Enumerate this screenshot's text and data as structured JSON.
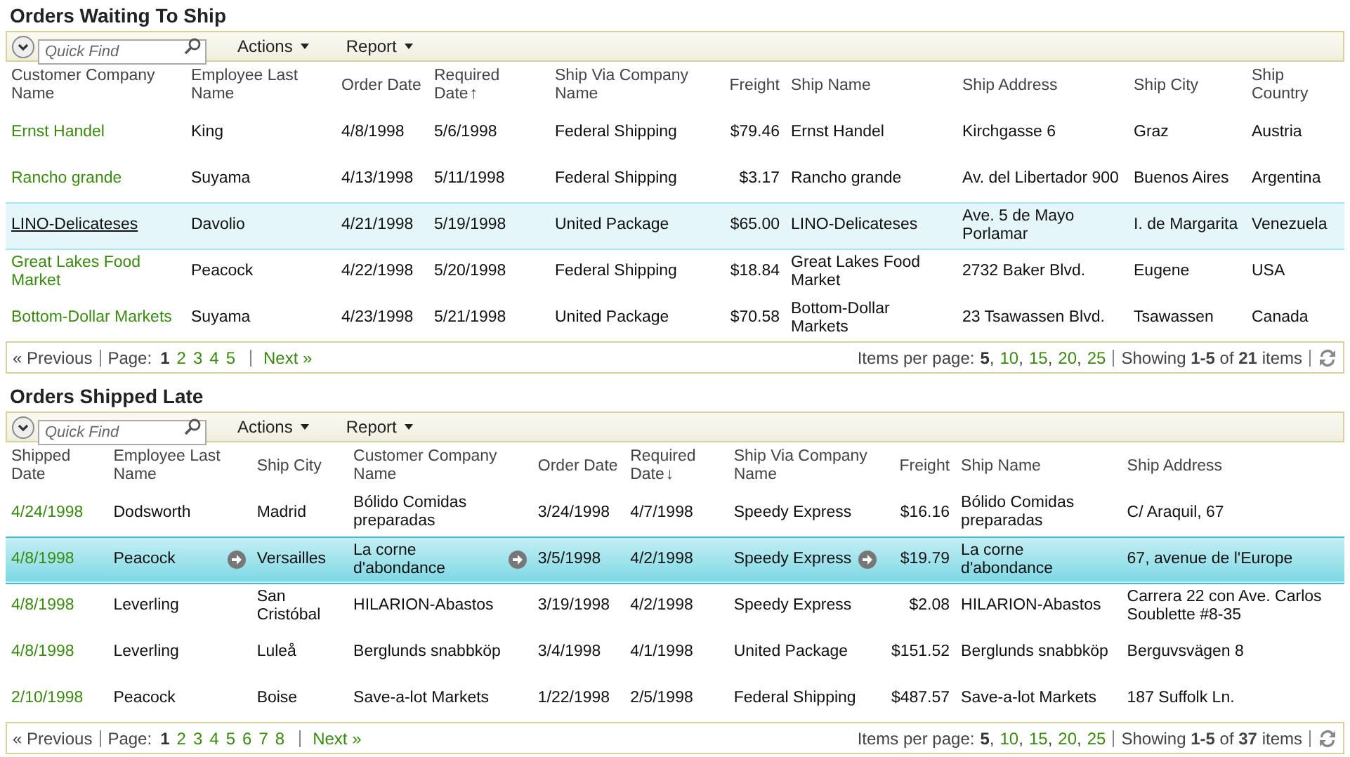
{
  "grids": [
    {
      "title": "Orders Waiting To Ship",
      "quick_find": {
        "placeholder": "Quick Find"
      },
      "menus": [
        "Actions",
        "Report"
      ],
      "columns": [
        {
          "label": "Customer Company Name",
          "kind": "link"
        },
        {
          "label": "Employee Last Name",
          "kind": "text"
        },
        {
          "label": "Order Date",
          "kind": "text"
        },
        {
          "label": "Required Date",
          "kind": "text",
          "sort_arrow": "↑"
        },
        {
          "label": "Ship Via Company Name",
          "kind": "text"
        },
        {
          "label": "Freight",
          "kind": "number"
        },
        {
          "label": "Ship Name",
          "kind": "text"
        },
        {
          "label": "Ship Address",
          "kind": "text"
        },
        {
          "label": "Ship City",
          "kind": "text"
        },
        {
          "label": "Ship Country",
          "kind": "text"
        }
      ],
      "rows": [
        {
          "selected": false,
          "hovered": false,
          "cells": [
            "Ernst Handel",
            "King",
            "4/8/1998",
            "5/6/1998",
            "Federal Shipping",
            "$79.46",
            "Ernst Handel",
            "Kirchgasse 6",
            "Graz",
            "Austria"
          ]
        },
        {
          "selected": false,
          "hovered": false,
          "cells": [
            "Rancho grande",
            "Suyama",
            "4/13/1998",
            "5/11/1998",
            "Federal Shipping",
            "$3.17",
            "Rancho grande",
            "Av. del Libertador 900",
            "Buenos Aires",
            "Argentina"
          ]
        },
        {
          "selected": false,
          "hovered": true,
          "cells": [
            "LINO-Delicateses",
            "Davolio",
            "4/21/1998",
            "5/19/1998",
            "United Package",
            "$65.00",
            "LINO-Delicateses",
            "Ave. 5 de Mayo Porlamar",
            "I. de Margarita",
            "Venezuela"
          ]
        },
        {
          "selected": false,
          "hovered": false,
          "cells": [
            "Great Lakes Food Market",
            "Peacock",
            "4/22/1998",
            "5/20/1998",
            "Federal Shipping",
            "$18.84",
            "Great Lakes Food Market",
            "2732 Baker Blvd.",
            "Eugene",
            "USA"
          ]
        },
        {
          "selected": false,
          "hovered": false,
          "cells": [
            "Bottom-Dollar Markets",
            "Suyama",
            "4/23/1998",
            "5/21/1998",
            "United Package",
            "$70.58",
            "Bottom-Dollar Markets",
            "23 Tsawassen Blvd.",
            "Tsawassen",
            "Canada"
          ]
        }
      ],
      "pager": {
        "previous": "« Previous",
        "page_label": "Page:",
        "pages": [
          {
            "label": "1",
            "selected": true
          },
          {
            "label": "2",
            "selected": false
          },
          {
            "label": "3",
            "selected": false
          },
          {
            "label": "4",
            "selected": false
          },
          {
            "label": "5",
            "selected": false
          }
        ],
        "next": "Next »",
        "items_label": "Items per page:",
        "separator": ",",
        "sizes": [
          {
            "label": "5",
            "selected": true
          },
          {
            "label": "10",
            "selected": false
          },
          {
            "label": "15",
            "selected": false
          },
          {
            "label": "20",
            "selected": false
          },
          {
            "label": "25",
            "selected": false
          }
        ],
        "showing": "Showing **1-5** of **21** items"
      }
    },
    {
      "title": "Orders Shipped Late",
      "quick_find": {
        "placeholder": "Quick Find"
      },
      "menus": [
        "Actions",
        "Report"
      ],
      "columns": [
        {
          "label": "Shipped Date",
          "kind": "link"
        },
        {
          "label": "Employee Last Name",
          "kind": "text",
          "action": true
        },
        {
          "label": "Ship City",
          "kind": "text"
        },
        {
          "label": "Customer Company Name",
          "kind": "text",
          "action": true
        },
        {
          "label": "Order Date",
          "kind": "text"
        },
        {
          "label": "Required Date",
          "kind": "text",
          "sort_arrow": "↓"
        },
        {
          "label": "Ship Via Company Name",
          "kind": "text",
          "action": true
        },
        {
          "label": "Freight",
          "kind": "number"
        },
        {
          "label": "Ship Name",
          "kind": "text"
        },
        {
          "label": "Ship Address",
          "kind": "text"
        }
      ],
      "rows": [
        {
          "selected": false,
          "hovered": false,
          "cells": [
            "4/24/1998",
            "Dodsworth",
            "Madrid",
            "Bólido Comidas preparadas",
            "3/24/1998",
            "4/7/1998",
            "Speedy Express",
            "$16.16",
            "Bólido Comidas preparadas",
            "C/ Araquil, 67"
          ]
        },
        {
          "selected": true,
          "hovered": false,
          "cells": [
            "4/8/1998",
            "Peacock",
            "Versailles",
            "La corne d'abondance",
            "3/5/1998",
            "4/2/1998",
            "Speedy Express",
            "$19.79",
            "La corne d'abondance",
            "67, avenue de l'Europe"
          ]
        },
        {
          "selected": false,
          "hovered": false,
          "cells": [
            "4/8/1998",
            "Leverling",
            "San Cristóbal",
            "HILARION-Abastos",
            "3/19/1998",
            "4/2/1998",
            "Speedy Express",
            "$2.08",
            "HILARION-Abastos",
            "Carrera 22 con Ave. Carlos Soublette #8-35"
          ]
        },
        {
          "selected": false,
          "hovered": false,
          "cells": [
            "4/8/1998",
            "Leverling",
            "Luleå",
            "Berglunds snabbköp",
            "3/4/1998",
            "4/1/1998",
            "United Package",
            "$151.52",
            "Berglunds snabbköp",
            "Berguvsvägen 8"
          ]
        },
        {
          "selected": false,
          "hovered": false,
          "cells": [
            "2/10/1998",
            "Peacock",
            "Boise",
            "Save-a-lot Markets",
            "1/22/1998",
            "2/5/1998",
            "Federal Shipping",
            "$487.57",
            "Save-a-lot Markets",
            "187 Suffolk Ln."
          ]
        }
      ],
      "pager": {
        "previous": "« Previous",
        "page_label": "Page:",
        "pages": [
          {
            "label": "1",
            "selected": true
          },
          {
            "label": "2",
            "selected": false
          },
          {
            "label": "3",
            "selected": false
          },
          {
            "label": "4",
            "selected": false
          },
          {
            "label": "5",
            "selected": false
          },
          {
            "label": "6",
            "selected": false
          },
          {
            "label": "7",
            "selected": false
          },
          {
            "label": "8",
            "selected": false
          }
        ],
        "next": "Next »",
        "items_label": "Items per page:",
        "separator": ",",
        "sizes": [
          {
            "label": "5",
            "selected": true
          },
          {
            "label": "10",
            "selected": false
          },
          {
            "label": "15",
            "selected": false
          },
          {
            "label": "20",
            "selected": false
          },
          {
            "label": "25",
            "selected": false
          }
        ],
        "showing": "Showing **1-5** of **37** items"
      }
    }
  ]
}
